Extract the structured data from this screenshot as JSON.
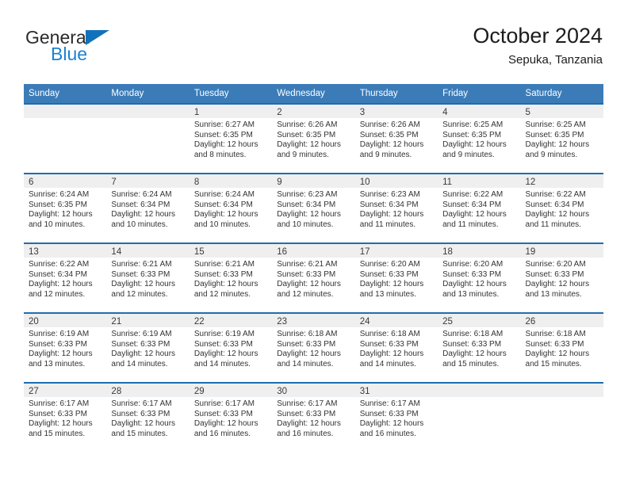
{
  "brand": {
    "name_part1": "General",
    "name_part2": "Blue",
    "logo_icon": "triangle-logo-icon",
    "color_dark": "#2b2b2b",
    "color_blue": "#1b82d2"
  },
  "header": {
    "title": "October 2024",
    "subtitle": "Sepuka, Tanzania"
  },
  "theme": {
    "header_blue": "#3b7cb8",
    "row_divider_blue": "#1f6cb0",
    "date_band_gray": "#efeff0"
  },
  "weekdays": [
    "Sunday",
    "Monday",
    "Tuesday",
    "Wednesday",
    "Thursday",
    "Friday",
    "Saturday"
  ],
  "weeks": [
    [
      {
        "day": "",
        "sunrise": "",
        "sunset": "",
        "daylight1": "",
        "daylight2": ""
      },
      {
        "day": "",
        "sunrise": "",
        "sunset": "",
        "daylight1": "",
        "daylight2": ""
      },
      {
        "day": "1",
        "sunrise": "Sunrise: 6:27 AM",
        "sunset": "Sunset: 6:35 PM",
        "daylight1": "Daylight: 12 hours",
        "daylight2": "and 8 minutes."
      },
      {
        "day": "2",
        "sunrise": "Sunrise: 6:26 AM",
        "sunset": "Sunset: 6:35 PM",
        "daylight1": "Daylight: 12 hours",
        "daylight2": "and 9 minutes."
      },
      {
        "day": "3",
        "sunrise": "Sunrise: 6:26 AM",
        "sunset": "Sunset: 6:35 PM",
        "daylight1": "Daylight: 12 hours",
        "daylight2": "and 9 minutes."
      },
      {
        "day": "4",
        "sunrise": "Sunrise: 6:25 AM",
        "sunset": "Sunset: 6:35 PM",
        "daylight1": "Daylight: 12 hours",
        "daylight2": "and 9 minutes."
      },
      {
        "day": "5",
        "sunrise": "Sunrise: 6:25 AM",
        "sunset": "Sunset: 6:35 PM",
        "daylight1": "Daylight: 12 hours",
        "daylight2": "and 9 minutes."
      }
    ],
    [
      {
        "day": "6",
        "sunrise": "Sunrise: 6:24 AM",
        "sunset": "Sunset: 6:35 PM",
        "daylight1": "Daylight: 12 hours",
        "daylight2": "and 10 minutes."
      },
      {
        "day": "7",
        "sunrise": "Sunrise: 6:24 AM",
        "sunset": "Sunset: 6:34 PM",
        "daylight1": "Daylight: 12 hours",
        "daylight2": "and 10 minutes."
      },
      {
        "day": "8",
        "sunrise": "Sunrise: 6:24 AM",
        "sunset": "Sunset: 6:34 PM",
        "daylight1": "Daylight: 12 hours",
        "daylight2": "and 10 minutes."
      },
      {
        "day": "9",
        "sunrise": "Sunrise: 6:23 AM",
        "sunset": "Sunset: 6:34 PM",
        "daylight1": "Daylight: 12 hours",
        "daylight2": "and 10 minutes."
      },
      {
        "day": "10",
        "sunrise": "Sunrise: 6:23 AM",
        "sunset": "Sunset: 6:34 PM",
        "daylight1": "Daylight: 12 hours",
        "daylight2": "and 11 minutes."
      },
      {
        "day": "11",
        "sunrise": "Sunrise: 6:22 AM",
        "sunset": "Sunset: 6:34 PM",
        "daylight1": "Daylight: 12 hours",
        "daylight2": "and 11 minutes."
      },
      {
        "day": "12",
        "sunrise": "Sunrise: 6:22 AM",
        "sunset": "Sunset: 6:34 PM",
        "daylight1": "Daylight: 12 hours",
        "daylight2": "and 11 minutes."
      }
    ],
    [
      {
        "day": "13",
        "sunrise": "Sunrise: 6:22 AM",
        "sunset": "Sunset: 6:34 PM",
        "daylight1": "Daylight: 12 hours",
        "daylight2": "and 12 minutes."
      },
      {
        "day": "14",
        "sunrise": "Sunrise: 6:21 AM",
        "sunset": "Sunset: 6:33 PM",
        "daylight1": "Daylight: 12 hours",
        "daylight2": "and 12 minutes."
      },
      {
        "day": "15",
        "sunrise": "Sunrise: 6:21 AM",
        "sunset": "Sunset: 6:33 PM",
        "daylight1": "Daylight: 12 hours",
        "daylight2": "and 12 minutes."
      },
      {
        "day": "16",
        "sunrise": "Sunrise: 6:21 AM",
        "sunset": "Sunset: 6:33 PM",
        "daylight1": "Daylight: 12 hours",
        "daylight2": "and 12 minutes."
      },
      {
        "day": "17",
        "sunrise": "Sunrise: 6:20 AM",
        "sunset": "Sunset: 6:33 PM",
        "daylight1": "Daylight: 12 hours",
        "daylight2": "and 13 minutes."
      },
      {
        "day": "18",
        "sunrise": "Sunrise: 6:20 AM",
        "sunset": "Sunset: 6:33 PM",
        "daylight1": "Daylight: 12 hours",
        "daylight2": "and 13 minutes."
      },
      {
        "day": "19",
        "sunrise": "Sunrise: 6:20 AM",
        "sunset": "Sunset: 6:33 PM",
        "daylight1": "Daylight: 12 hours",
        "daylight2": "and 13 minutes."
      }
    ],
    [
      {
        "day": "20",
        "sunrise": "Sunrise: 6:19 AM",
        "sunset": "Sunset: 6:33 PM",
        "daylight1": "Daylight: 12 hours",
        "daylight2": "and 13 minutes."
      },
      {
        "day": "21",
        "sunrise": "Sunrise: 6:19 AM",
        "sunset": "Sunset: 6:33 PM",
        "daylight1": "Daylight: 12 hours",
        "daylight2": "and 14 minutes."
      },
      {
        "day": "22",
        "sunrise": "Sunrise: 6:19 AM",
        "sunset": "Sunset: 6:33 PM",
        "daylight1": "Daylight: 12 hours",
        "daylight2": "and 14 minutes."
      },
      {
        "day": "23",
        "sunrise": "Sunrise: 6:18 AM",
        "sunset": "Sunset: 6:33 PM",
        "daylight1": "Daylight: 12 hours",
        "daylight2": "and 14 minutes."
      },
      {
        "day": "24",
        "sunrise": "Sunrise: 6:18 AM",
        "sunset": "Sunset: 6:33 PM",
        "daylight1": "Daylight: 12 hours",
        "daylight2": "and 14 minutes."
      },
      {
        "day": "25",
        "sunrise": "Sunrise: 6:18 AM",
        "sunset": "Sunset: 6:33 PM",
        "daylight1": "Daylight: 12 hours",
        "daylight2": "and 15 minutes."
      },
      {
        "day": "26",
        "sunrise": "Sunrise: 6:18 AM",
        "sunset": "Sunset: 6:33 PM",
        "daylight1": "Daylight: 12 hours",
        "daylight2": "and 15 minutes."
      }
    ],
    [
      {
        "day": "27",
        "sunrise": "Sunrise: 6:17 AM",
        "sunset": "Sunset: 6:33 PM",
        "daylight1": "Daylight: 12 hours",
        "daylight2": "and 15 minutes."
      },
      {
        "day": "28",
        "sunrise": "Sunrise: 6:17 AM",
        "sunset": "Sunset: 6:33 PM",
        "daylight1": "Daylight: 12 hours",
        "daylight2": "and 15 minutes."
      },
      {
        "day": "29",
        "sunrise": "Sunrise: 6:17 AM",
        "sunset": "Sunset: 6:33 PM",
        "daylight1": "Daylight: 12 hours",
        "daylight2": "and 16 minutes."
      },
      {
        "day": "30",
        "sunrise": "Sunrise: 6:17 AM",
        "sunset": "Sunset: 6:33 PM",
        "daylight1": "Daylight: 12 hours",
        "daylight2": "and 16 minutes."
      },
      {
        "day": "31",
        "sunrise": "Sunrise: 6:17 AM",
        "sunset": "Sunset: 6:33 PM",
        "daylight1": "Daylight: 12 hours",
        "daylight2": "and 16 minutes."
      },
      {
        "day": "",
        "sunrise": "",
        "sunset": "",
        "daylight1": "",
        "daylight2": ""
      },
      {
        "day": "",
        "sunrise": "",
        "sunset": "",
        "daylight1": "",
        "daylight2": ""
      }
    ]
  ]
}
